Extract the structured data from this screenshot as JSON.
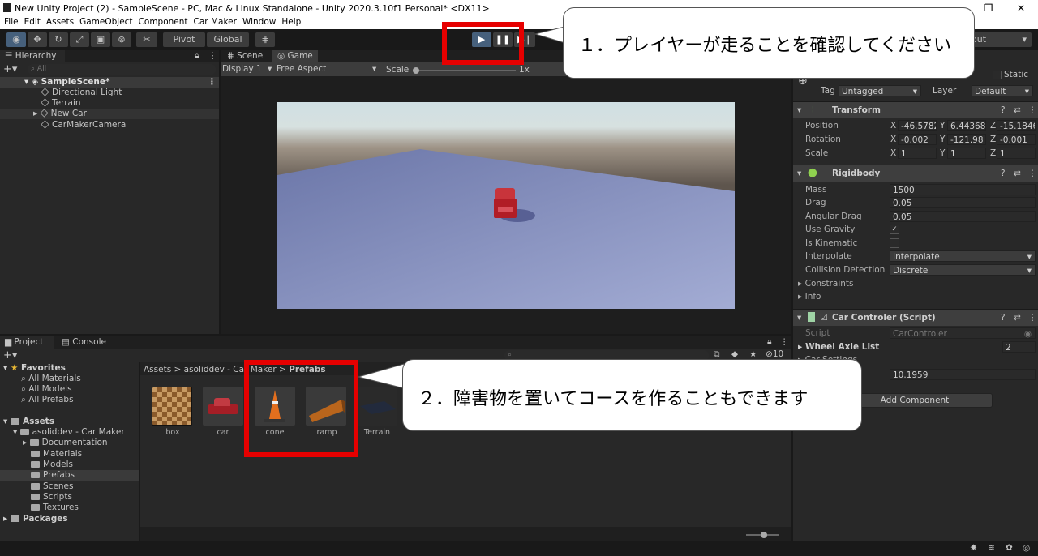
{
  "window": {
    "title": "New Unity Project (2) - SampleScene - PC, Mac & Linux Standalone - Unity 2020.3.10f1 Personal* <DX11>"
  },
  "menu": [
    "File",
    "Edit",
    "Assets",
    "GameObject",
    "Component",
    "Car Maker",
    "Window",
    "Help"
  ],
  "toolbar": {
    "pivot": "Pivot",
    "global": "Global",
    "layout": "out"
  },
  "hierarchy": {
    "tab": "Hierarchy",
    "search": "All",
    "scene": "SampleScene*",
    "items": [
      "Directional Light",
      "Terrain",
      "New Car",
      "CarMakerCamera"
    ]
  },
  "scene_tabs": {
    "scene": "Scene",
    "game": "Game",
    "display": "Display 1",
    "aspect": "Free Aspect",
    "scale_label": "Scale",
    "scale_value": "1x"
  },
  "inspector": {
    "static": "Static",
    "tag_label": "Tag",
    "tag": "Untagged",
    "layer_label": "Layer",
    "layer": "Default",
    "transform": {
      "name": "Transform",
      "position_label": "Position",
      "rotation_label": "Rotation",
      "scale_label": "Scale",
      "position": {
        "x": "-46.5782",
        "y": "6.44368",
        "z": "-15.1846"
      },
      "rotation": {
        "x": "-0.002",
        "y": "-121.98",
        "z": "-0.001"
      },
      "scale": {
        "x": "1",
        "y": "1",
        "z": "1"
      }
    },
    "rigidbody": {
      "name": "Rigidbody",
      "mass_label": "Mass",
      "mass": "1500",
      "drag_label": "Drag",
      "drag": "0.05",
      "angular_label": "Angular Drag",
      "angular": "0.05",
      "gravity_label": "Use Gravity",
      "kinematic_label": "Is Kinematic",
      "interp_label": "Interpolate",
      "interp": "Interpolate",
      "collision_label": "Collision Detection",
      "collision": "Discrete",
      "constraints": "Constraints",
      "info": "Info"
    },
    "script": {
      "name": "Car Controler (Script)",
      "script_label": "Script",
      "script": "CarControler",
      "wheel_label": "Wheel Axle List",
      "wheel": "2",
      "car_settings": "Car Settings",
      "value": "10.1959"
    },
    "add_component": "Add Component"
  },
  "project": {
    "tab": "Project",
    "console": "Console",
    "favorites": "Favorites",
    "fav_items": [
      "All Materials",
      "All Models",
      "All Prefabs"
    ],
    "assets": "Assets",
    "car_maker": "asoliddev - Car Maker",
    "folders": [
      "Documentation",
      "Materials",
      "Models",
      "Prefabs",
      "Scenes",
      "Scripts",
      "Textures"
    ],
    "packages": "Packages",
    "breadcrumb": {
      "a": "Assets",
      "b": "asoliddev - Car Maker",
      "c": "Prefabs"
    },
    "prefabs": [
      "box",
      "car",
      "cone",
      "ramp",
      "Terrain"
    ],
    "count": "10"
  },
  "callouts": {
    "one": "１．プレイヤーが走ることを確認してください",
    "two": "２．障害物を置いてコースを作ることもできます"
  },
  "colors": {
    "highlight": "#e60000",
    "play_active": "#46607c"
  }
}
